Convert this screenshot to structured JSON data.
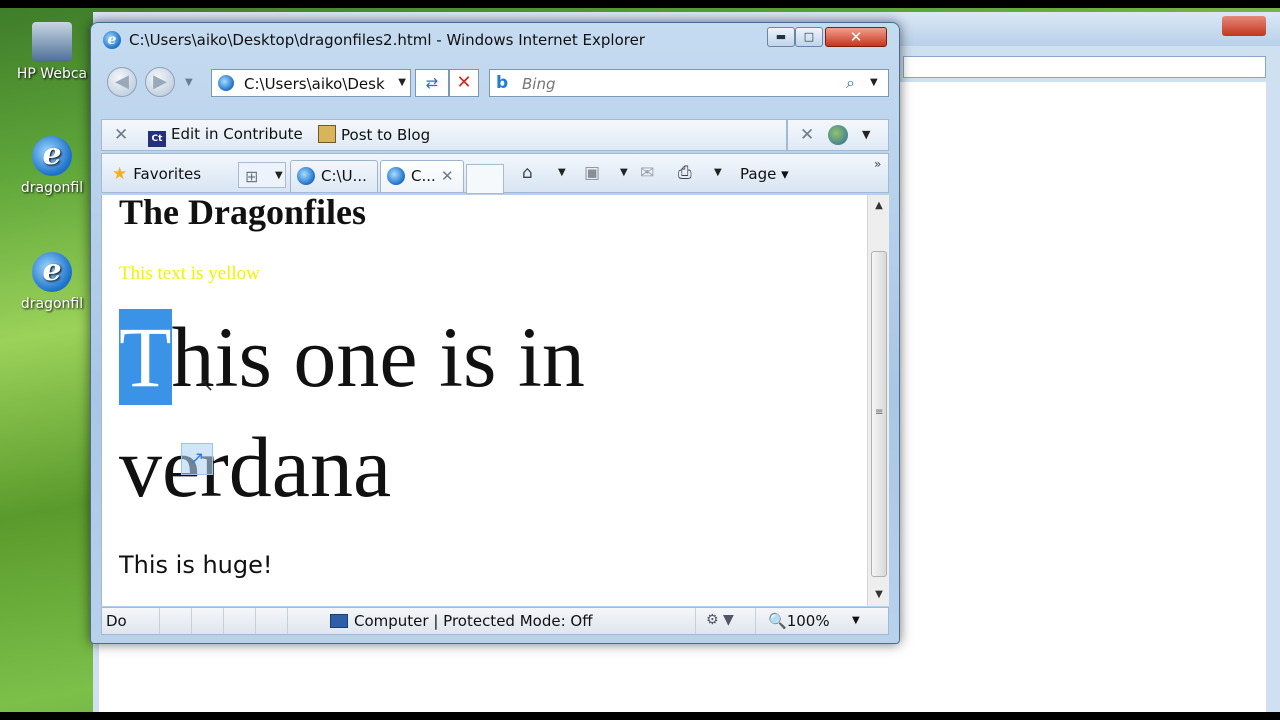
{
  "window": {
    "title": "C:\\Users\\aiko\\Desktop\\dragonfiles2.html - Windows Internet Explorer",
    "minimize": "▬",
    "maximize": "□",
    "close": "✕"
  },
  "desktop": {
    "icons": [
      {
        "label": "HP Webca"
      },
      {
        "label": "dragonfil"
      },
      {
        "label": "dragonfil"
      }
    ]
  },
  "nav": {
    "address": "C:\\Users\\aiko\\Desk",
    "search_placeholder": "Bing"
  },
  "toolbar": {
    "contribute_label": "Edit in Contribute",
    "contribute_icon_text": "Ct",
    "blog_label": "Post to Blog"
  },
  "favorites_bar": {
    "favorites_label": "Favorites",
    "tabs": [
      {
        "label": "C:\\U..."
      },
      {
        "label": "C..."
      }
    ],
    "page_label": "Page ▾",
    "chevrons": "»"
  },
  "content": {
    "heading": "The Dragonfiles",
    "yellow_text": "This text is yellow",
    "huge_first_letter": "T",
    "huge_rest": "his one is in verdana",
    "caption": "This is huge!",
    "colors": {
      "yellow": "#f5f000",
      "selection": "#3b93e8"
    }
  },
  "status": {
    "text": "Do",
    "zone": "Computer | Protected Mode: Off",
    "zoom": "100%"
  }
}
